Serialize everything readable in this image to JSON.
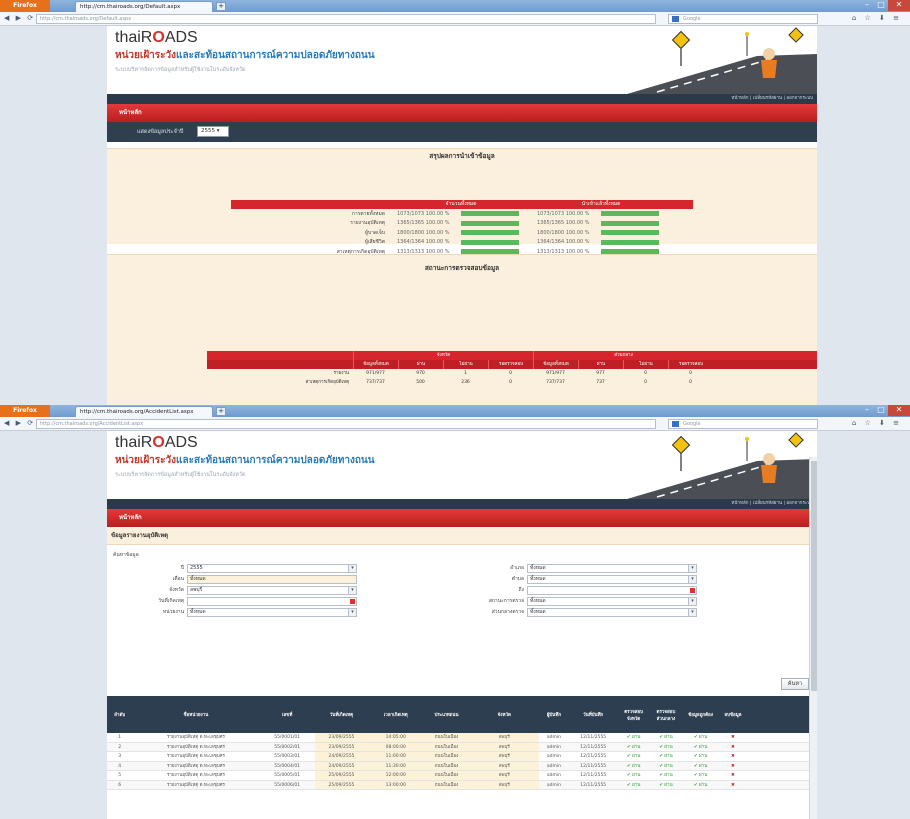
{
  "top": {
    "browser": {
      "menu_button": "Firefox",
      "tab_title": "http://cm.thairoads.org/Default.aspx",
      "new_tab": "+",
      "url": "http://cm.thairoads.org/Default.aspx",
      "search_placeholder": "Google"
    },
    "header": {
      "logo_prefix": "thaiR",
      "logo_o": "O",
      "logo_suffix": "ADS",
      "title_red": "หน่วยเฝ้าระวัง",
      "title_blue": "และสะท้อนสถานการณ์ความปลอดภัยทางถนน",
      "subtitle": "ระบบบริหารจัดการข้อมูลสำหรับผู้ใช้งานในระดับจังหวัด"
    },
    "topbar_links": "หน้าหลัก | เปลี่ยนรหัสผ่าน | ออกจากระบบ",
    "redbar_label": "หน้าหลัก",
    "year": {
      "label": "แสดงข้อมูลประจำปี",
      "value": "2555"
    },
    "summary": {
      "title": "สรุปผลการนำเข้าข้อมูล",
      "col1": "จำนวนทั้งหมด",
      "col2": "นำเข้าแล้วทั้งหมด",
      "rows": [
        {
          "label": "การตายทั้งหมด",
          "v1": "1073/1073 100.00 %",
          "v2": "1073/1073 100.00 %"
        },
        {
          "label": "รายงานอุบัติเหตุ",
          "v1": "1365/1365 100.00 %",
          "v2": "1365/1365 100.00 %"
        },
        {
          "label": "ผู้บาดเจ็บ",
          "v1": "1800/1800 100.00 %",
          "v2": "1800/1800 100.00 %"
        },
        {
          "label": "ผู้เสียชีวิต",
          "v1": "1364/1364 100.00 %",
          "v2": "1364/1364 100.00 %"
        },
        {
          "label": "สาเหตุการเกิดอุบัติเหตุ",
          "v1": "1313/1313 100.00 %",
          "v2": "1313/1313 100.00 %"
        },
        {
          "label": "สถานที่เกิดอุบัติเหตุ",
          "v1": "1021/1021 100.00 %",
          "v2": "1021/1021 100.00 %"
        },
        {
          "label": "รวมทั้งหมด",
          "v1": "1530/1530 100.00 %",
          "v2": "1530/1530 100.00 %"
        }
      ]
    },
    "lower": {
      "title": "สถานะการตรวจสอบข้อมูล",
      "group1": "จังหวัด",
      "group2": "ส่วนกลาง",
      "sub": [
        "ข้อมูลทั้งหมด",
        "ผ่าน",
        "ไม่ผ่าน",
        "รอตรวจสอบ",
        "ข้อมูลทั้งหมด",
        "ผ่าน",
        "ไม่ผ่าน",
        "รอตรวจสอบ"
      ],
      "rows": [
        {
          "label": "รายงาน",
          "vals": [
            "971/977",
            "970",
            "1",
            "0",
            "971/977",
            "977",
            "0",
            "0"
          ]
        },
        {
          "label": "สาเหตุการเกิดอุบัติเหตุ",
          "vals": [
            "737/737",
            "500",
            "236",
            "0",
            "737/737",
            "737",
            "0",
            "0"
          ]
        }
      ]
    }
  },
  "bottom": {
    "browser": {
      "menu_button": "Firefox",
      "tab_title": "http://cm.thairoads.org/AccidentList.aspx",
      "new_tab": "+",
      "url": "http://cm.thairoads.org/AccidentList.aspx",
      "search_placeholder": "Google"
    },
    "header": {
      "logo_prefix": "thaiR",
      "logo_o": "O",
      "logo_suffix": "ADS",
      "title_red": "หน่วยเฝ้าระวัง",
      "title_blue": "และสะท้อนสถานการณ์ความปลอดภัยทางถนน",
      "subtitle": "ระบบบริหารจัดการข้อมูลสำหรับผู้ใช้งานในระดับจังหวัด"
    },
    "topbar_links": "หน้าหลัก | เปลี่ยนรหัสผ่าน | ออกจากระบบ",
    "redbar_label": "หน้าหลัก",
    "section_title": "ข้อมูลรายงานอุบัติเหตุ",
    "filter_title": "ค้นหาข้อมูล",
    "filters_left": [
      {
        "label": "ปี",
        "value": "2555",
        "kind": "select"
      },
      {
        "label": "เดือน",
        "value": "ทั้งหมด",
        "kind": "readonly"
      },
      {
        "label": "จังหวัด",
        "value": "ลพบุรี",
        "kind": "select"
      },
      {
        "label": "วันที่เกิดเหตุ",
        "value": "",
        "kind": "date"
      },
      {
        "label": "หน่วยงาน",
        "value": "ทั้งหมด",
        "kind": "select"
      }
    ],
    "filters_right": [
      {
        "label": "อำเภอ",
        "value": "ทั้งหมด",
        "kind": "select"
      },
      {
        "label": "ตำบล",
        "value": "ทั้งหมด",
        "kind": "select"
      },
      {
        "label": "ถึง",
        "value": "",
        "kind": "date"
      },
      {
        "label": "สถานะการตรวจ",
        "value": "ทั้งหมด",
        "kind": "select"
      },
      {
        "label": "ส่วนกลางตรวจ",
        "value": "ทั้งหมด",
        "kind": "select"
      }
    ],
    "search_button": "ค้นหา",
    "columns": [
      "ลำดับ",
      "ชื่อหน่วยงาน",
      "เลขที่",
      "วันที่เกิดเหตุ",
      "เวลาเกิดเหตุ",
      "ประเภทถนน",
      "จังหวัด",
      "ผู้บันทึก",
      "วันที่บันทึก",
      "ตรวจสอบ จังหวัด",
      "ตรวจสอบ ส่วนกลาง",
      "ข้อมูลถูกต้อง",
      "ลบข้อมูล"
    ],
    "rows": [
      {
        "no": "1",
        "unit": "รายงานอุบัติเหตุ ต.ทะเลชุบศร",
        "id": "55/0001/01",
        "date": "23/09/2555",
        "time": "14:05:00",
        "road": "ถนนในเมือง",
        "prov": "ลพบุรี",
        "rec": "admin",
        "rdate": "12/11/2555",
        "c1": "✔ ผ่าน",
        "c2": "✔ ผ่าน",
        "c3": "✔ ผ่าน",
        "del": "✖"
      },
      {
        "no": "2",
        "unit": "รายงานอุบัติเหตุ ต.ทะเลชุบศร",
        "id": "55/0002/01",
        "date": "23/09/2555",
        "time": "08:00:00",
        "road": "ถนนในเมือง",
        "prov": "ลพบุรี",
        "rec": "admin",
        "rdate": "12/11/2555",
        "c1": "✔ ผ่าน",
        "c2": "✔ ผ่าน",
        "c3": "✔ ผ่าน",
        "del": "✖"
      },
      {
        "no": "3",
        "unit": "รายงานอุบัติเหตุ ต.ทะเลชุบศร",
        "id": "55/0003/01",
        "date": "24/09/2555",
        "time": "11:00:00",
        "road": "ถนนในเมือง",
        "prov": "ลพบุรี",
        "rec": "admin",
        "rdate": "12/11/2555",
        "c1": "✔ ผ่าน",
        "c2": "✔ ผ่าน",
        "c3": "✔ ผ่าน",
        "del": "✖"
      },
      {
        "no": "4",
        "unit": "รายงานอุบัติเหตุ ต.ทะเลชุบศร",
        "id": "55/0004/01",
        "date": "24/09/2555",
        "time": "11:30:00",
        "road": "ถนนในเมือง",
        "prov": "ลพบุรี",
        "rec": "admin",
        "rdate": "12/11/2555",
        "c1": "✔ ผ่าน",
        "c2": "✔ ผ่าน",
        "c3": "✔ ผ่าน",
        "del": "✖"
      },
      {
        "no": "5",
        "unit": "รายงานอุบัติเหตุ ต.ทะเลชุบศร",
        "id": "55/0005/01",
        "date": "25/09/2555",
        "time": "12:00:00",
        "road": "ถนนในเมือง",
        "prov": "ลพบุรี",
        "rec": "admin",
        "rdate": "12/11/2555",
        "c1": "✔ ผ่าน",
        "c2": "✔ ผ่าน",
        "c3": "✔ ผ่าน",
        "del": "✖"
      },
      {
        "no": "6",
        "unit": "รายงานอุบัติเหตุ ต.ทะเลชุบศร",
        "id": "55/0006/01",
        "date": "25/09/2555",
        "time": "13:00:00",
        "road": "ถนนในเมือง",
        "prov": "ลพบุรี",
        "rec": "admin",
        "rdate": "12/11/2555",
        "c1": "✔ ผ่าน",
        "c2": "✔ ผ่าน",
        "c3": "✔ ผ่าน",
        "del": "✖"
      }
    ]
  },
  "colors": {
    "accent_red": "#d6262d",
    "dark_navy": "#2d3e50",
    "progress_green": "#5cb85c",
    "panel_cream": "#fbf0dd"
  }
}
